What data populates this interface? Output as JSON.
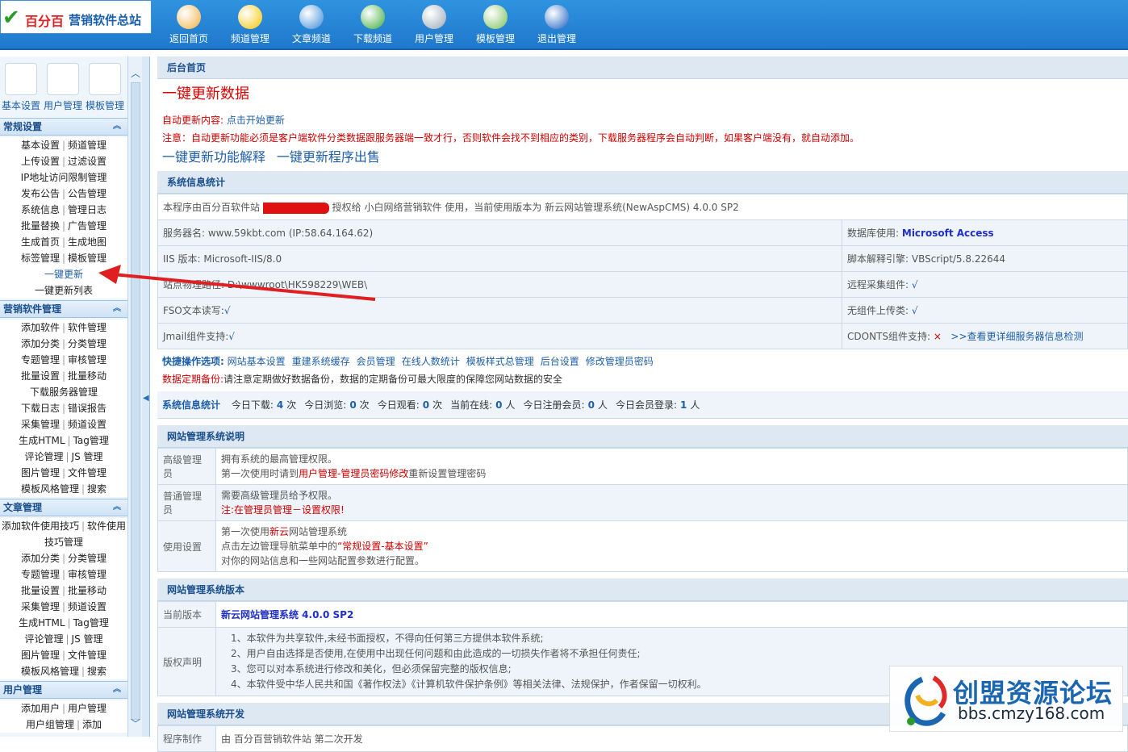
{
  "logo": {
    "mark": "✔",
    "brand": "百分百",
    "name": "营销软件总站"
  },
  "topnav": [
    {
      "label": "返回首页",
      "icon": "home-icon",
      "color": "#f0b040"
    },
    {
      "label": "频道管理",
      "icon": "monitor-icon",
      "color": "#f5c400"
    },
    {
      "label": "文章频道",
      "icon": "document-icon",
      "color": "#3a8ad8"
    },
    {
      "label": "下载频道",
      "icon": "download-icon",
      "color": "#3aaa3a"
    },
    {
      "label": "用户管理",
      "icon": "users-icon",
      "color": "#9aa8b8"
    },
    {
      "label": "模板管理",
      "icon": "palette-icon",
      "color": "#7ac05a"
    },
    {
      "label": "退出管理",
      "icon": "power-icon",
      "color": "#1a5fc0"
    }
  ],
  "left_icons": [
    {
      "label": "基本设置",
      "icon": "settings-gears-icon"
    },
    {
      "label": "用户管理",
      "icon": "user-icon"
    },
    {
      "label": "模板管理",
      "icon": "template-icon"
    }
  ],
  "groups": [
    {
      "title": "常规设置",
      "items": [
        [
          "基本设置",
          "频道管理"
        ],
        [
          "上传设置",
          "过滤设置"
        ],
        [
          "IP地址访问限制管理"
        ],
        [
          "发布公告",
          "公告管理"
        ],
        [
          "系统信息",
          "管理日志"
        ],
        [
          "批量替换",
          "广告管理"
        ],
        [
          "生成首页",
          "生成地图"
        ],
        [
          "标签管理",
          "模板管理"
        ],
        [
          "一键更新"
        ],
        [
          "一键更新列表"
        ]
      ]
    },
    {
      "title": "营销软件管理",
      "items": [
        [
          "添加软件",
          "软件管理"
        ],
        [
          "添加分类",
          "分类管理"
        ],
        [
          "专题管理",
          "审核管理"
        ],
        [
          "批量设置",
          "批量移动"
        ],
        [
          "下载服务器管理"
        ],
        [
          "下载日志",
          "错误报告"
        ],
        [
          "采集管理",
          "频道设置"
        ],
        [
          "生成HTML",
          "Tag管理"
        ],
        [
          "评论管理",
          "JS 管理"
        ],
        [
          "图片管理",
          "文件管理"
        ],
        [
          "模板风格管理",
          "搜索"
        ]
      ]
    },
    {
      "title": "文章管理",
      "items": [
        [
          "添加软件使用技巧",
          "软件使用技巧管理"
        ],
        [
          "添加分类",
          "分类管理"
        ],
        [
          "专题管理",
          "审核管理"
        ],
        [
          "批量设置",
          "批量移动"
        ],
        [
          "采集管理",
          "频道设置"
        ],
        [
          "生成HTML",
          "Tag管理"
        ],
        [
          "评论管理",
          "JS 管理"
        ],
        [
          "图片管理",
          "文件管理"
        ],
        [
          "模板风格管理",
          "搜索"
        ]
      ]
    },
    {
      "title": "用户管理",
      "items": [
        [
          "添加用户",
          "用户管理"
        ],
        [
          "用户组管理",
          "添加"
        ]
      ]
    }
  ],
  "main": {
    "breadcrumb": "后台首页",
    "title": "一键更新数据",
    "auto_update_label": "自动更新内容:",
    "auto_update_link": "点击开始更新",
    "notice": "注意：自动更新功能必须是客户端软件分类数据跟服务器端一致才行，否则软件会找不到相应的类别，下载服务器程序会自动判断，如果客户端没有，就自动添加。",
    "link1": "一键更新功能解释",
    "link2": "一键更新程序出售",
    "sysinfo_title": "系统信息统计",
    "license_pre": "本程序由百分百软件站",
    "license_post": "授权给 小白网络营销软件 使用，当前使用版本为 新云网站管理系统(NewAspCMS) 4.0.0 SP2",
    "server_name": "服务器名: www.59kbt.com (IP:58.64.164.62)",
    "db_label": "数据库使用:",
    "db_value": "Microsoft Access",
    "iis": "IIS 版本:  Microsoft-IIS/8.0",
    "script_engine": "脚本解释引擎: VBScript/5.8.22644",
    "path": "站点物理路径: D:\\wwwroot\\HK598229\\WEB\\",
    "remote": "远程采集组件:",
    "fso": "FSO文本读写:",
    "upload": "无组件上传类:",
    "jmail": "Jmail组件支持:",
    "cdonts": "CDONTS组件支持:",
    "check": "√",
    "cross": "×",
    "server_detail": ">>查看更详细服务器信息检测",
    "quick_label": "快捷操作选项:",
    "quick_links": [
      "网站基本设置",
      "重建系统缓存",
      "会员管理",
      "在线人数统计",
      "模板样式总管理",
      "后台设置",
      "修改管理员密码"
    ],
    "backup_label": "数据定期备份:",
    "backup_text": "请注意定期做好数据备份，数据的定期备份可最大限度的保障您网站数据的安全",
    "stats_label": "系统信息统计",
    "stats": [
      {
        "label": "今日下载:",
        "value": "4",
        "unit": "次"
      },
      {
        "label": "今日浏览:",
        "value": "0",
        "unit": "次"
      },
      {
        "label": "今日观看:",
        "value": "0",
        "unit": "次"
      },
      {
        "label": "当前在线:",
        "value": "0",
        "unit": "人"
      },
      {
        "label": "今日注册会员:",
        "value": "0",
        "unit": "人"
      },
      {
        "label": "今日会员登录:",
        "value": "1",
        "unit": "人"
      }
    ],
    "desc_title": "网站管理系统说明",
    "roles": [
      {
        "name": "高级管理员",
        "lines": [
          "拥有系统的最高管理权限。",
          "第一次使用时请到",
          "用户管理-管理员密码修改",
          "重新设置管理密码"
        ]
      },
      {
        "name": "普通管理员",
        "lines": [
          "需要高级管理员给予权限。",
          "注:",
          "在管理员管理－设置权限!"
        ]
      },
      {
        "name": "使用设置",
        "lines": [
          "第一次使用",
          "新云",
          "网站管理系统",
          "点击左边管理导航菜单中的",
          "“常规设置-基本设置”",
          "对你的网站信息和一些网站配置参数进行配置。"
        ]
      }
    ],
    "version_title": "网站管理系统版本",
    "current_label": "当前版本",
    "current_value": "新云网站管理系统 4.0.0 SP2",
    "copyright_label": "版权声明",
    "copyright": [
      "1、本软件为共享软件,未经书面授权，不得向任何第三方提供本软件系统;",
      "2、用户自由选择是否使用,在使用中出现任何问题和由此造成的一切损失作者将不承担任何责任;",
      "3、您可以对本系统进行修改和美化，但必须保留完整的版权信息;",
      "4、本软件受中华人民共和国《著作权法》《计算机软件保护条例》等相关法律、法规保护，作者保留一切权利。"
    ],
    "dev_title": "网站管理系统开发",
    "maker_label": "程序制作",
    "maker_value": "由 百分百营销软件站 第二次开发"
  },
  "watermark": {
    "title": "创盟资源论坛",
    "url": "bbs.cmzy168.com"
  }
}
